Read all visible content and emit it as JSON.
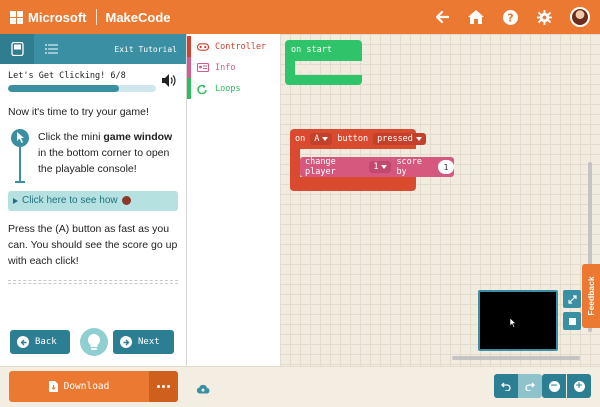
{
  "header": {
    "brand": "Microsoft",
    "product": "MakeCode"
  },
  "tutorial": {
    "exit_label": "Exit Tutorial",
    "progress_label": "Let's Get Clicking! 6/8",
    "progress_fraction": 0.75,
    "intro": "Now it's time to try your game!",
    "hint_pre": "Click the mini ",
    "hint_bold": "game window",
    "hint_post": " in the bottom corner to open the playable console!",
    "see_how": "Click here to see how",
    "press_text": "Press the (A) button as fast as you can. You should see the score go up with each click!",
    "back_label": "Back",
    "next_label": "Next"
  },
  "toolbox": {
    "categories": [
      {
        "label": "Controller",
        "icon": "gamepad-icon",
        "color": "#d3402b"
      },
      {
        "label": "Info",
        "icon": "id-card-icon",
        "color": "#d45b8a"
      },
      {
        "label": "Loops",
        "icon": "loop-icon",
        "color": "#2dbd5b"
      }
    ]
  },
  "blocks": {
    "on_start": "on start",
    "on_button": {
      "prefix": "on",
      "button": "A",
      "middle": "button",
      "event": "pressed"
    },
    "change_score": {
      "prefix": "change player",
      "player": "1",
      "middle": "score by",
      "value": "1"
    }
  },
  "side": {
    "feedback": "Feedback"
  },
  "bottom": {
    "download_label": "Download"
  },
  "colors": {
    "accent": "#ec7932",
    "teal": "#3a8fa2",
    "event_block": "#d94a2e",
    "info_block": "#d6587f",
    "loops_block": "#2fc46a"
  }
}
